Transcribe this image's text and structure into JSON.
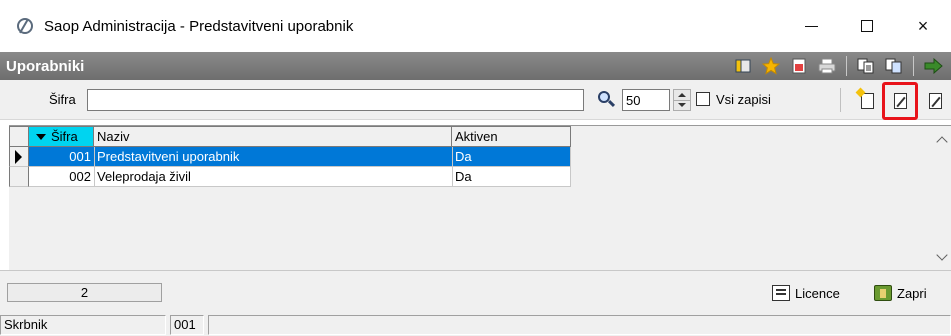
{
  "window": {
    "title": "Saop Administracija - Predstavitveni uporabnik",
    "minimize": "",
    "maximize": "",
    "close": "×"
  },
  "header": {
    "title": "Uporabniki"
  },
  "search": {
    "label": "Šifra",
    "value": "",
    "count": "50",
    "all_records_label": "Vsi zapisi",
    "all_records_checked": false
  },
  "table": {
    "columns": [
      "Šifra",
      "Naziv",
      "Aktiven"
    ],
    "sorted_column": "Šifra",
    "rows": [
      {
        "sifra": "001",
        "naziv": "Predstavitveni uporabnik",
        "aktiven": "Da",
        "selected": true
      },
      {
        "sifra": "002",
        "naziv": "Veleprodaja živil",
        "aktiven": "Da",
        "selected": false
      }
    ]
  },
  "footer": {
    "record_count": "2",
    "license_button": "Licence",
    "close_button": "Zapri"
  },
  "status": {
    "user_label": "Skrbnik",
    "user_code": "001",
    "message": ""
  },
  "colors": {
    "header_bg": "#7a7a7a",
    "selection": "#0078d7",
    "sort_column": "#00d4f0",
    "highlight": "#e8131a"
  }
}
